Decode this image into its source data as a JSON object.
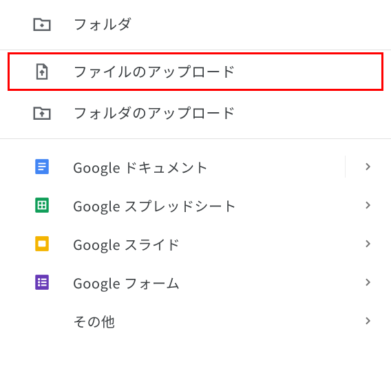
{
  "menu": {
    "folder": {
      "label": "フォルダ"
    },
    "file_upload": {
      "label": "ファイルのアップロード"
    },
    "folder_upload": {
      "label": "フォルダのアップロード"
    },
    "apps": [
      {
        "label": "Google ドキュメント"
      },
      {
        "label": "Google スプレッドシート"
      },
      {
        "label": "Google スライド"
      },
      {
        "label": "Google フォーム"
      }
    ],
    "other": {
      "label": "その他"
    }
  },
  "colors": {
    "docs": "#4285f4",
    "sheets": "#0f9d58",
    "slides": "#f4b400",
    "forms": "#673ab7"
  }
}
